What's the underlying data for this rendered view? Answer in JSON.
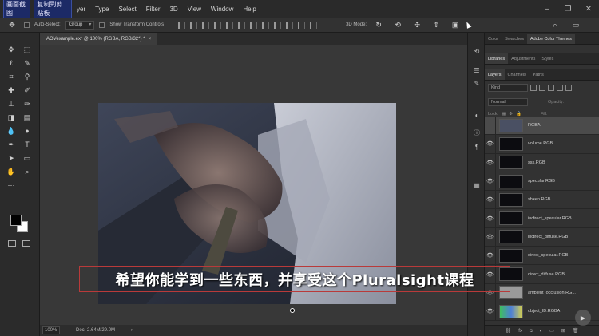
{
  "menubar": {
    "overlay_label_1": "画面截图",
    "overlay_label_2": "复制到剪贴板",
    "items": [
      "yer",
      "Type",
      "Select",
      "Filter",
      "3D",
      "View",
      "Window",
      "Help"
    ]
  },
  "options_bar": {
    "auto_select_label": "Auto-Select:",
    "auto_select_value": "Group",
    "show_transform_label": "Show Transform Controls",
    "mode_label": "3D Mode:"
  },
  "document_tab": {
    "title": "AOVexample.exr @ 100% (RGBA, RGB/32*) *",
    "close_glyph": "×"
  },
  "status_bar": {
    "zoom": "100%",
    "doc_info": "Doc: 2.64M/29.0M"
  },
  "panels": {
    "top_tabs": [
      "Color",
      "Swatches",
      "Adobe Color Themes"
    ],
    "mid_tabs": [
      "Libraries",
      "Adjustments",
      "Styles"
    ],
    "layer_tabs": [
      "Layers",
      "Channels",
      "Paths"
    ],
    "filter_label": "Kind",
    "blend_mode": "Normal",
    "opacity_label": "Opacity:",
    "fill_label": "Fill:",
    "lock_label": "Lock:",
    "layers": [
      {
        "name": "RGBA",
        "selected": true,
        "visible": false
      },
      {
        "name": "volume.RGB",
        "selected": false,
        "visible": true
      },
      {
        "name": "sss.RGB",
        "selected": false,
        "visible": true
      },
      {
        "name": "specular.RGB",
        "selected": false,
        "visible": true
      },
      {
        "name": "sheen.RGB",
        "selected": false,
        "visible": true
      },
      {
        "name": "indirect_specular.RGB",
        "selected": false,
        "visible": true
      },
      {
        "name": "indirect_diffuse.RGB",
        "selected": false,
        "visible": true
      },
      {
        "name": "direct_specular.RGB",
        "selected": false,
        "visible": true
      },
      {
        "name": "direct_diffuse.RGB",
        "selected": false,
        "visible": true
      },
      {
        "name": "ambient_occlusion.RG...",
        "selected": false,
        "visible": true
      },
      {
        "name": "object_ID.RGBA",
        "selected": false,
        "visible": true
      }
    ]
  },
  "subtitle": {
    "text": "希望你能学到一些东西，并享受这个Pluralsight课程"
  },
  "colors": {
    "foreground": "#000000",
    "background": "#ffffff",
    "subtitle_border": "#b93a3a"
  }
}
